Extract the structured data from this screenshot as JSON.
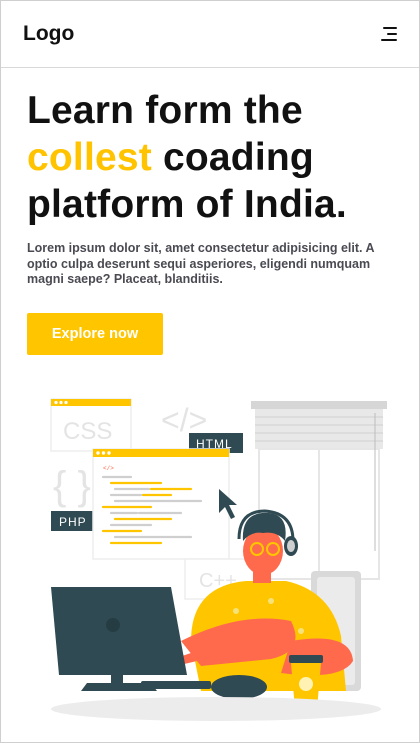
{
  "navbar": {
    "logo": "Logo",
    "menu_icon": "hamburger-menu-icon"
  },
  "hero": {
    "title_line1": "Learn form the",
    "title_accent": "collest",
    "title_line2_rest": " coading",
    "title_line3": "platform of India.",
    "description": "Lorem ipsum dolor sit, amet consectetur adipisicing elit. A optio culpa deserunt sequi asperiores, eligendi numquam magni saepe? Placeat, blanditiis.",
    "cta_label": "Explore now"
  },
  "illustration": {
    "css_label": "CSS",
    "html_label": "HTML",
    "php_label": "PHP",
    "cpp_label": "C++",
    "code_brackets": "</>",
    "curly_braces": "{ }",
    "editor_tag": "</>"
  },
  "colors": {
    "accent": "#ffc600",
    "text": "#111111",
    "muted": "#4a4a52",
    "dark_teal": "#2f4a52",
    "skin": "#ff6a4d"
  }
}
